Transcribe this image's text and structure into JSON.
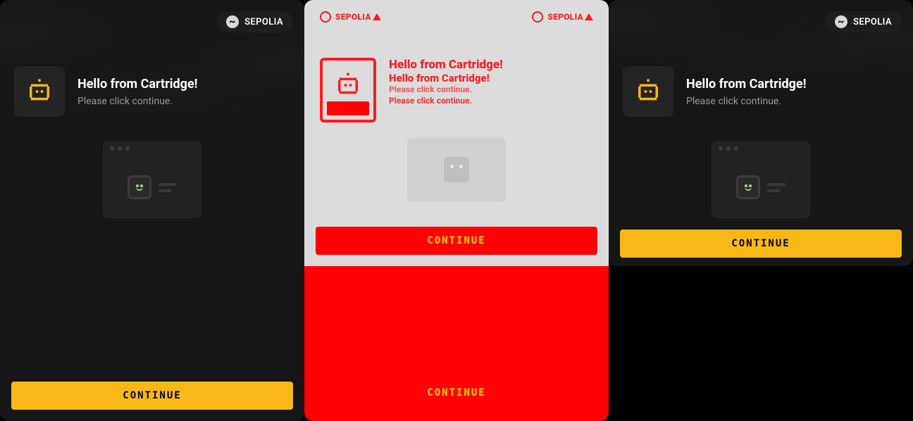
{
  "network": {
    "label": "SEPOLIA"
  },
  "header": {
    "title": "Hello from Cartridge!",
    "subtitle": "Please click continue."
  },
  "diff_header": {
    "title1": "Hello from Cartridge!",
    "title2": "Hello from Cartridge!",
    "sub1": "Please click continue.",
    "sub2": "Please click continue."
  },
  "action": {
    "continue": "CONTINUE"
  }
}
